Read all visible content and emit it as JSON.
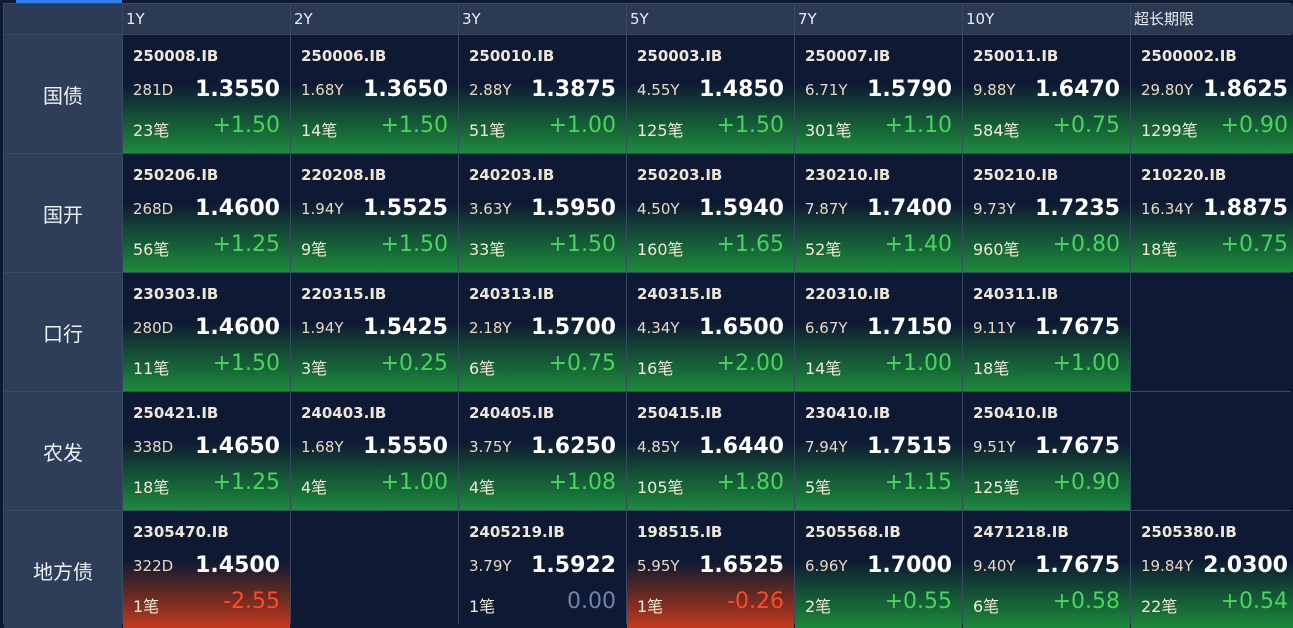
{
  "columns": [
    "1Y",
    "2Y",
    "3Y",
    "5Y",
    "7Y",
    "10Y",
    "超长期限"
  ],
  "rows": [
    {
      "label": "国债",
      "cells": [
        {
          "code": "250008.IB",
          "term": "281D",
          "yield": "1.3550",
          "count": "23笔",
          "change": "+1.50",
          "trend": "up"
        },
        {
          "code": "250006.IB",
          "term": "1.68Y",
          "yield": "1.3650",
          "count": "14笔",
          "change": "+1.50",
          "trend": "up"
        },
        {
          "code": "250010.IB",
          "term": "2.88Y",
          "yield": "1.3875",
          "count": "51笔",
          "change": "+1.00",
          "trend": "up"
        },
        {
          "code": "250003.IB",
          "term": "4.55Y",
          "yield": "1.4850",
          "count": "125笔",
          "change": "+1.50",
          "trend": "up"
        },
        {
          "code": "250007.IB",
          "term": "6.71Y",
          "yield": "1.5790",
          "count": "301笔",
          "change": "+1.10",
          "trend": "up"
        },
        {
          "code": "250011.IB",
          "term": "9.88Y",
          "yield": "1.6470",
          "count": "584笔",
          "change": "+0.75",
          "trend": "up"
        },
        {
          "code": "2500002.IB",
          "term": "29.80Y",
          "yield": "1.8625",
          "count": "1299笔",
          "change": "+0.90",
          "trend": "up"
        }
      ]
    },
    {
      "label": "国开",
      "cells": [
        {
          "code": "250206.IB",
          "term": "268D",
          "yield": "1.4600",
          "count": "56笔",
          "change": "+1.25",
          "trend": "up"
        },
        {
          "code": "220208.IB",
          "term": "1.94Y",
          "yield": "1.5525",
          "count": "9笔",
          "change": "+1.50",
          "trend": "up"
        },
        {
          "code": "240203.IB",
          "term": "3.63Y",
          "yield": "1.5950",
          "count": "33笔",
          "change": "+1.50",
          "trend": "up"
        },
        {
          "code": "250203.IB",
          "term": "4.50Y",
          "yield": "1.5940",
          "count": "160笔",
          "change": "+1.65",
          "trend": "up"
        },
        {
          "code": "230210.IB",
          "term": "7.87Y",
          "yield": "1.7400",
          "count": "52笔",
          "change": "+1.40",
          "trend": "up"
        },
        {
          "code": "250210.IB",
          "term": "9.73Y",
          "yield": "1.7235",
          "count": "960笔",
          "change": "+0.80",
          "trend": "up"
        },
        {
          "code": "210220.IB",
          "term": "16.34Y",
          "yield": "1.8875",
          "count": "18笔",
          "change": "+0.75",
          "trend": "up"
        }
      ]
    },
    {
      "label": "口行",
      "cells": [
        {
          "code": "230303.IB",
          "term": "280D",
          "yield": "1.4600",
          "count": "11笔",
          "change": "+1.50",
          "trend": "up"
        },
        {
          "code": "220315.IB",
          "term": "1.94Y",
          "yield": "1.5425",
          "count": "3笔",
          "change": "+0.25",
          "trend": "up"
        },
        {
          "code": "240313.IB",
          "term": "2.18Y",
          "yield": "1.5700",
          "count": "6笔",
          "change": "+0.75",
          "trend": "up"
        },
        {
          "code": "240315.IB",
          "term": "4.34Y",
          "yield": "1.6500",
          "count": "16笔",
          "change": "+2.00",
          "trend": "up"
        },
        {
          "code": "220310.IB",
          "term": "6.67Y",
          "yield": "1.7150",
          "count": "14笔",
          "change": "+1.00",
          "trend": "up"
        },
        {
          "code": "240311.IB",
          "term": "9.11Y",
          "yield": "1.7675",
          "count": "18笔",
          "change": "+1.00",
          "trend": "up"
        },
        null
      ]
    },
    {
      "label": "农发",
      "cells": [
        {
          "code": "250421.IB",
          "term": "338D",
          "yield": "1.4650",
          "count": "18笔",
          "change": "+1.25",
          "trend": "up"
        },
        {
          "code": "240403.IB",
          "term": "1.68Y",
          "yield": "1.5550",
          "count": "4笔",
          "change": "+1.00",
          "trend": "up"
        },
        {
          "code": "240405.IB",
          "term": "3.75Y",
          "yield": "1.6250",
          "count": "4笔",
          "change": "+1.08",
          "trend": "up"
        },
        {
          "code": "250415.IB",
          "term": "4.85Y",
          "yield": "1.6440",
          "count": "105笔",
          "change": "+1.80",
          "trend": "up"
        },
        {
          "code": "230410.IB",
          "term": "7.94Y",
          "yield": "1.7515",
          "count": "5笔",
          "change": "+1.15",
          "trend": "up"
        },
        {
          "code": "250410.IB",
          "term": "9.51Y",
          "yield": "1.7675",
          "count": "125笔",
          "change": "+0.90",
          "trend": "up"
        },
        null
      ]
    },
    {
      "label": "地方债",
      "cells": [
        {
          "code": "2305470.IB",
          "term": "322D",
          "yield": "1.4500",
          "count": "1笔",
          "change": "-2.55",
          "trend": "down"
        },
        null,
        {
          "code": "2405219.IB",
          "term": "3.79Y",
          "yield": "1.5922",
          "count": "1笔",
          "change": "0.00",
          "trend": "flat"
        },
        {
          "code": "198515.IB",
          "term": "5.95Y",
          "yield": "1.6525",
          "count": "1笔",
          "change": "-0.26",
          "trend": "down"
        },
        {
          "code": "2505568.IB",
          "term": "6.96Y",
          "yield": "1.7000",
          "count": "2笔",
          "change": "+0.55",
          "trend": "up"
        },
        {
          "code": "2471218.IB",
          "term": "9.40Y",
          "yield": "1.7675",
          "count": "6笔",
          "change": "+0.58",
          "trend": "up"
        },
        {
          "code": "2505380.IB",
          "term": "19.84Y",
          "yield": "2.0300",
          "count": "22笔",
          "change": "+0.54",
          "trend": "up"
        }
      ]
    }
  ],
  "colors": {
    "up": "#47d65a",
    "down": "#ff4a2a",
    "flat": "#6f86a8",
    "accent": "#2f7fe6"
  }
}
